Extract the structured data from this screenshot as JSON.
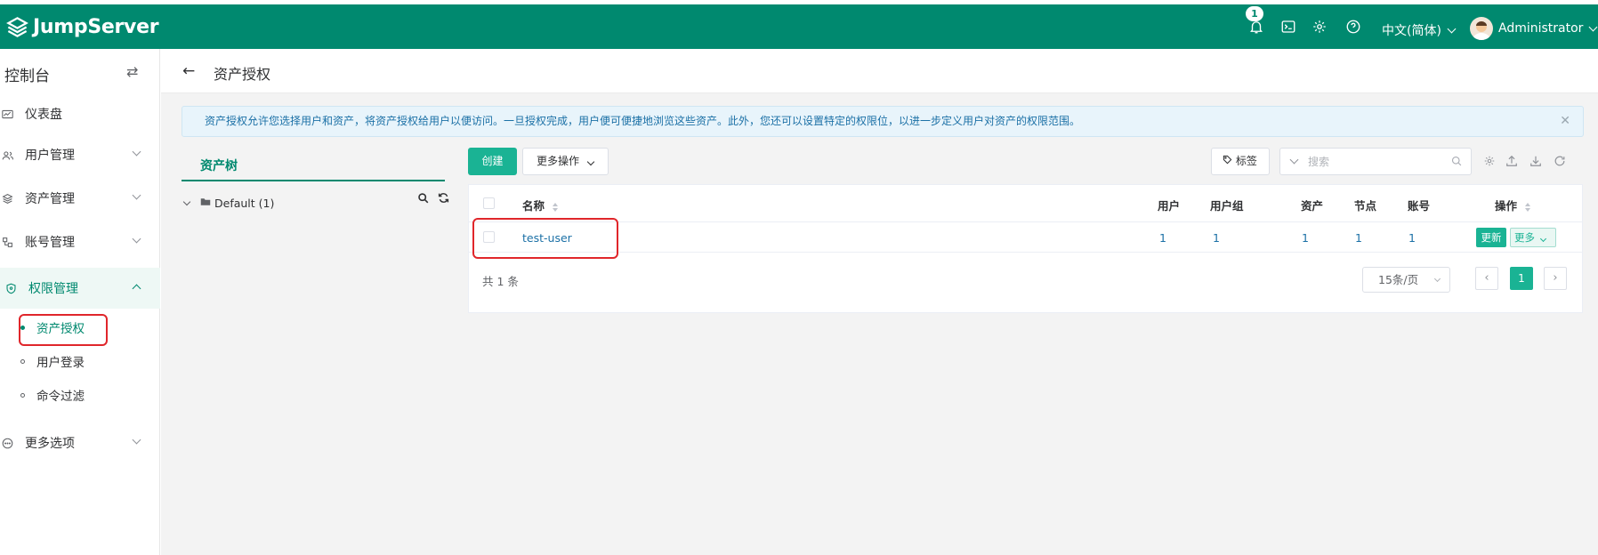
{
  "topbar": {
    "brand": "JumpServer",
    "notification_count": "1",
    "language": "中文(简体)",
    "username": "Administrator",
    "icons": [
      "bell-icon",
      "terminal-icon",
      "gear-icon",
      "help-icon"
    ]
  },
  "sidebar": {
    "title": "控制台",
    "items": [
      {
        "label": "仪表盘",
        "icon": "dashboard-icon"
      },
      {
        "label": "用户管理",
        "icon": "users-icon"
      },
      {
        "label": "资产管理",
        "icon": "assets-icon"
      },
      {
        "label": "账号管理",
        "icon": "accounts-icon"
      },
      {
        "label": "权限管理",
        "icon": "shield-icon"
      },
      {
        "label": "更多选项",
        "icon": "more-icon"
      }
    ],
    "subitems": [
      {
        "label": "资产授权"
      },
      {
        "label": "用户登录"
      },
      {
        "label": "命令过滤"
      }
    ]
  },
  "page": {
    "title": "资产授权",
    "alert": "资产授权允许您选择用户和资产，将资产授权给用户以便访问。一旦授权完成，用户便可便捷地浏览这些资产。此外，您还可以设置特定的权限位，以进一步定义用户对资产的权限范围。"
  },
  "tree": {
    "tab": "资产树",
    "node": "Default (1)"
  },
  "toolbar": {
    "create": "创建",
    "more_actions": "更多操作",
    "tag": "标签",
    "search_placeholder": "搜索"
  },
  "table": {
    "columns": [
      "名称",
      "用户",
      "用户组",
      "资产",
      "节点",
      "账号",
      "操作"
    ],
    "rows": [
      {
        "name": "test-user",
        "users": "1",
        "user_groups": "1",
        "assets": "1",
        "nodes": "1",
        "accounts": "1"
      }
    ],
    "update_label": "更新",
    "more_label": "更多"
  },
  "pagination": {
    "total": "共 1 条",
    "page_size": "15条/页",
    "current_page": "1"
  },
  "colors": {
    "brand": "#00896f",
    "primary_button": "#1ab394",
    "highlight": "#e0262b"
  }
}
